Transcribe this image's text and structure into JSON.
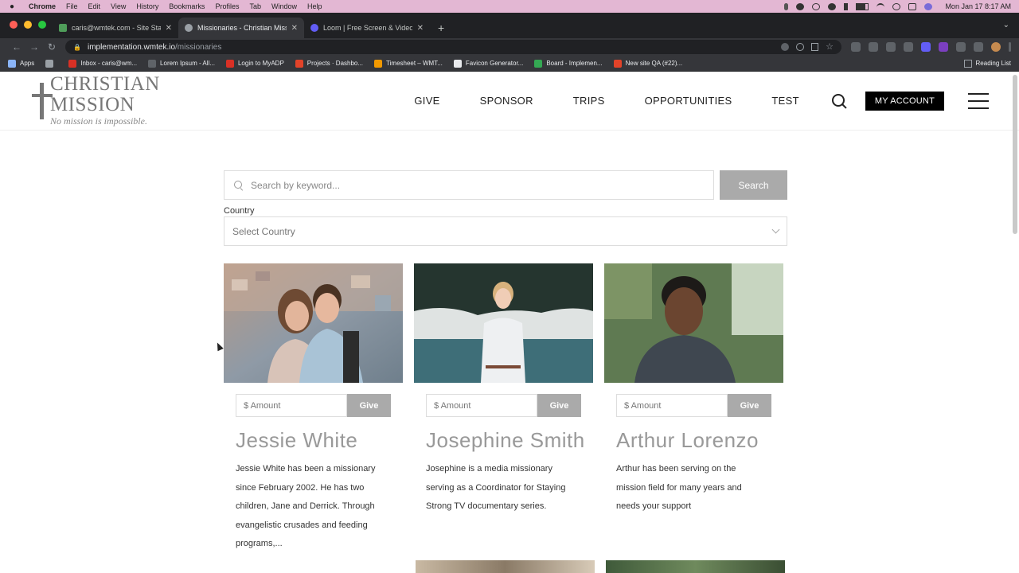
{
  "macbar": {
    "app": "Chrome",
    "menus": [
      "File",
      "Edit",
      "View",
      "History",
      "Bookmarks",
      "Profiles",
      "Tab",
      "Window",
      "Help"
    ],
    "clock": "Mon Jan 17  8:17 AM"
  },
  "tabs": [
    {
      "title": "caris@wmtek.com - Site Stacks",
      "color": "#4f9d5a"
    },
    {
      "title": "Missionaries - Christian Missio",
      "color": "#9aa0a6"
    },
    {
      "title": "Loom | Free Screen & Video Re",
      "color": "#625df5"
    }
  ],
  "address": {
    "host": "implementation.wmtek.io",
    "path": "/missionaries"
  },
  "bookmarks": [
    {
      "label": "Apps",
      "color": "#8ab4f8"
    },
    {
      "label": "",
      "color": "#9aa0a6"
    },
    {
      "label": "Inbox - caris@wm...",
      "color": "#d93025"
    },
    {
      "label": "Lorem Ipsum - All...",
      "color": "#5f6368"
    },
    {
      "label": "Login to MyADP",
      "color": "#d93025"
    },
    {
      "label": "Projects · Dashbo...",
      "color": "#e24329"
    },
    {
      "label": "Timesheet – WMT...",
      "color": "#f29900"
    },
    {
      "label": "Favicon Generator...",
      "color": "#e8eaed"
    },
    {
      "label": "Board - Implemen...",
      "color": "#34a853"
    },
    {
      "label": "New site QA (#22)...",
      "color": "#e24329"
    }
  ],
  "reading_list": "Reading List",
  "site": {
    "logo_name": "CHRISTIAN MISSION",
    "logo_tag": "No mission is impossible.",
    "nav": [
      "GIVE",
      "SPONSOR",
      "TRIPS",
      "OPPORTUNITIES",
      "TEST"
    ],
    "account": "MY ACCOUNT"
  },
  "search": {
    "placeholder": "Search by keyword...",
    "button": "Search"
  },
  "country": {
    "label": "Country",
    "placeholder": "Select Country"
  },
  "missionaries": [
    {
      "name": "Jessie White",
      "desc": "Jessie White has been a missionary since February 2002. He has two children, Jane and Derrick. Through evangelistic crusades and feeding programs,...",
      "amount_placeholder": "$ Amount",
      "give": "Give"
    },
    {
      "name": "Josephine Smith",
      "desc": "Josephine is a media missionary serving as a Coordinator for Staying Strong TV documentary series.",
      "amount_placeholder": "$ Amount",
      "give": "Give"
    },
    {
      "name": "Arthur Lorenzo",
      "desc": "Arthur has been serving on the mission field for many years and needs your support",
      "amount_placeholder": "$ Amount",
      "give": "Give"
    }
  ]
}
